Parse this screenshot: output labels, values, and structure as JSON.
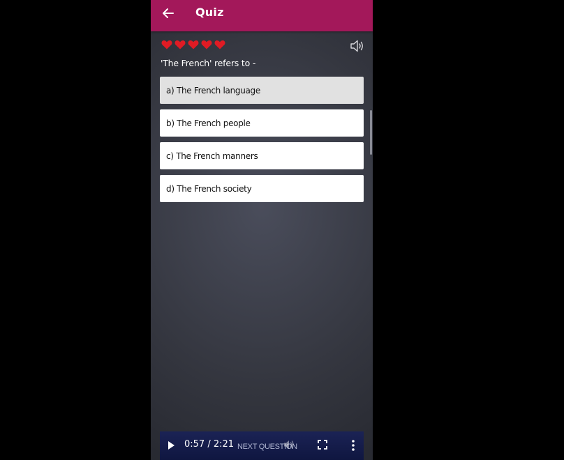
{
  "app": {
    "title": "Quiz"
  },
  "quiz": {
    "lives": 5,
    "question": "'The French' refers to -",
    "options": [
      {
        "label": "a) The French language",
        "selected": true
      },
      {
        "label": "b) The French people",
        "selected": false
      },
      {
        "label": "c) The French manners",
        "selected": false
      },
      {
        "label": "d) The French society",
        "selected": false
      }
    ]
  },
  "video": {
    "time": "0:57 / 2:21",
    "overlay_label": "NEXT QUESTION"
  },
  "icons": {
    "back": "arrow-left-icon",
    "heart": "heart-icon",
    "sound": "speaker-icon",
    "play": "play-icon",
    "volume": "volume-icon",
    "fullscreen": "fullscreen-icon",
    "more": "more-vertical-icon"
  },
  "colors": {
    "appbar": "#a3185a",
    "heart": "#e01b24",
    "option_bg": "#ffffff",
    "option_selected_bg": "#e1e1e1",
    "video_bar": "#1b2355"
  }
}
